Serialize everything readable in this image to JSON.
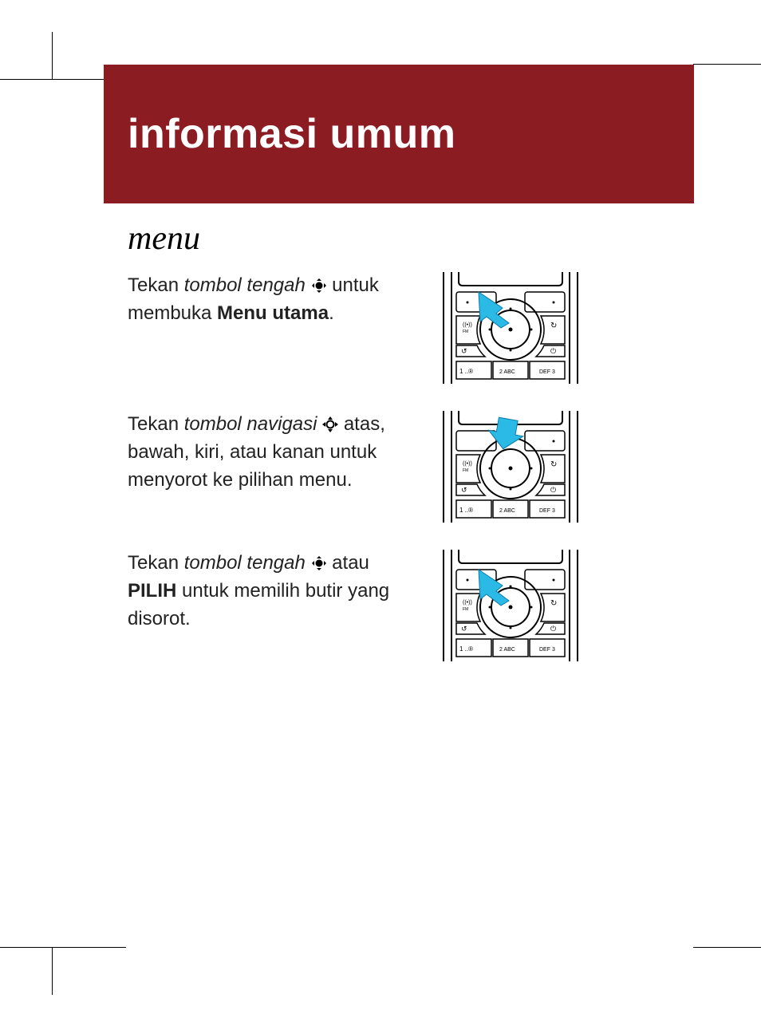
{
  "header": {
    "title": "informasi umum"
  },
  "section": {
    "title": "menu"
  },
  "para1": {
    "t1": "Tekan ",
    "italic": "tombol tengah",
    "t2": " untuk membuka ",
    "bold": "Menu utama",
    "t3": "."
  },
  "para2": {
    "t1": "Tekan ",
    "italic": "tombol navigasi",
    "t2": " atas, bawah, kiri, atau kanan untuk menyorot ke pilihan menu."
  },
  "para3": {
    "t1": "Tekan ",
    "italic": "tombol tengah",
    "t2": " atau ",
    "bold": "PILIH",
    "t3": " untuk memilih butir yang disorot."
  },
  "keypad": {
    "key1": "1 ..®",
    "key2": "2 ABC",
    "key3": "DEF 3",
    "fm": "FM"
  }
}
